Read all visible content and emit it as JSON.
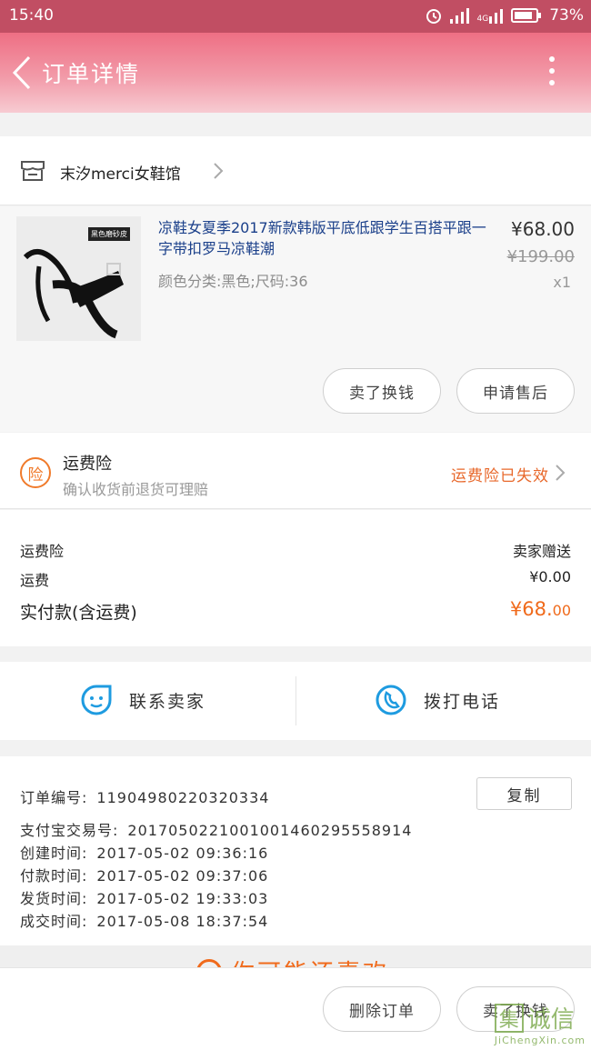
{
  "status_bar": {
    "time": "15:40",
    "network": "4G",
    "battery": "73%"
  },
  "header": {
    "title": "订单详情"
  },
  "shop": {
    "name": "末汐merci女鞋馆"
  },
  "product": {
    "title": "凉鞋女夏季2017新款韩版平底低跟学生百搭平跟一字带扣罗马凉鞋潮",
    "spec": "颜色分类:黑色;尺码:36",
    "price": "¥68.00",
    "original_price": "¥199.00",
    "quantity": "x1",
    "image_tag": "黑色磨砂皮",
    "actions": {
      "sell": "卖了换钱",
      "after_sale": "申请售后"
    }
  },
  "insurance": {
    "badge": "险",
    "title": "运费险",
    "subtitle": "确认收货前退货可理赔",
    "status": "运费险已失效"
  },
  "fees": {
    "rows": [
      {
        "label": "运费险",
        "value": "卖家赠送"
      },
      {
        "label": "运费",
        "value": "¥0.00"
      }
    ],
    "total_label": "实付款(含运费)",
    "total_main": "¥68.",
    "total_cents": "00"
  },
  "contact": {
    "seller": "联系卖家",
    "phone": "拨打电话"
  },
  "order_info": {
    "copy_label": "复制",
    "lines": [
      {
        "label": "订单编号:",
        "value": "11904980220320334"
      },
      {
        "label": "支付宝交易号:",
        "value": "2017050221001001460295558914"
      },
      {
        "label": "创建时间:",
        "value": "2017-05-02 09:36:16"
      },
      {
        "label": "付款时间:",
        "value": "2017-05-02 09:37:06"
      },
      {
        "label": "发货时间:",
        "value": "2017-05-02 19:33:03"
      },
      {
        "label": "成交时间:",
        "value": "2017-05-08 18:37:54"
      }
    ]
  },
  "peek": {
    "text": "你可能还喜欢"
  },
  "bottom": {
    "delete": "删除订单",
    "sell": "卖了换钱"
  },
  "watermark": {
    "brand": "诚信",
    "domain": "JiChengXin.com"
  },
  "colors": {
    "accent": "#f06a1b",
    "header": "#ee6f84",
    "link": "#1a3f8a",
    "contact_icon": "#1e9be0"
  }
}
